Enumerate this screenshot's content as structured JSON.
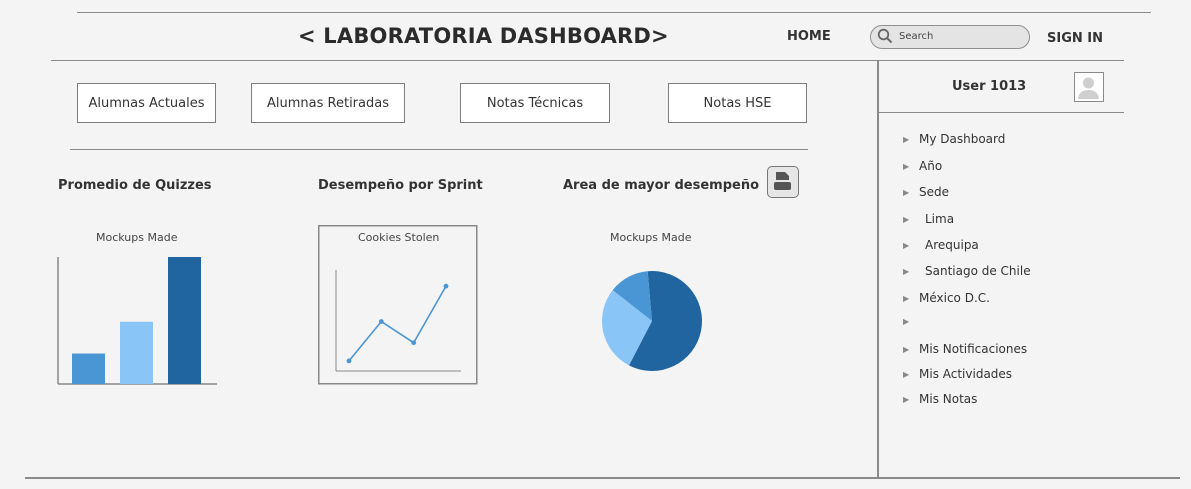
{
  "header": {
    "title": "< LABORATORIA DASHBOARD>",
    "home": "HOME",
    "search_placeholder": "Search",
    "sign_in": "SIGN IN"
  },
  "tabs": [
    {
      "label": "Alumnas Actuales"
    },
    {
      "label": "Alumnas Retiradas"
    },
    {
      "label": "Notas Técnicas"
    },
    {
      "label": "Notas HSE"
    }
  ],
  "charts_section": {
    "quizzes_title": "Promedio de Quizzes",
    "sprint_title": "Desempeño por Sprint",
    "area_title": "Area de mayor desempeño"
  },
  "chart_data": [
    {
      "type": "bar",
      "title": "Mockups Made",
      "categories": [
        "",
        "",
        ""
      ],
      "values": [
        24,
        49,
        100
      ],
      "ylim": [
        0,
        100
      ],
      "colors": [
        "#4a95d4",
        "#89c5f7",
        "#2064a0"
      ]
    },
    {
      "type": "line",
      "title": "Cookies Stolen",
      "x": [
        1,
        2,
        3,
        4
      ],
      "y": [
        10,
        49,
        28,
        84
      ],
      "ylim": [
        0,
        100
      ],
      "color": "#4a95d4"
    },
    {
      "type": "pie",
      "title": "Mockups Made",
      "values": [
        59,
        28,
        13
      ],
      "colors": [
        "#2064a0",
        "#89c5f7",
        "#4a95d4"
      ]
    }
  ],
  "sidebar": {
    "user": "User 1013",
    "items": [
      {
        "label": "My Dashboard",
        "indent": 0
      },
      {
        "label": "Año",
        "indent": 0
      },
      {
        "label": "Sede",
        "indent": 0
      },
      {
        "label": "Lima",
        "indent": 1
      },
      {
        "label": "Arequipa",
        "indent": 1
      },
      {
        "label": "Santiago de Chile",
        "indent": 1
      },
      {
        "label": "México D.C.",
        "indent": 0
      },
      {
        "label": "",
        "indent": 0
      },
      {
        "label": "Mis Notificaciones",
        "indent": 0
      },
      {
        "label": "Mis Actividades",
        "indent": 0
      },
      {
        "label": "Mis Notas",
        "indent": 0
      }
    ]
  }
}
